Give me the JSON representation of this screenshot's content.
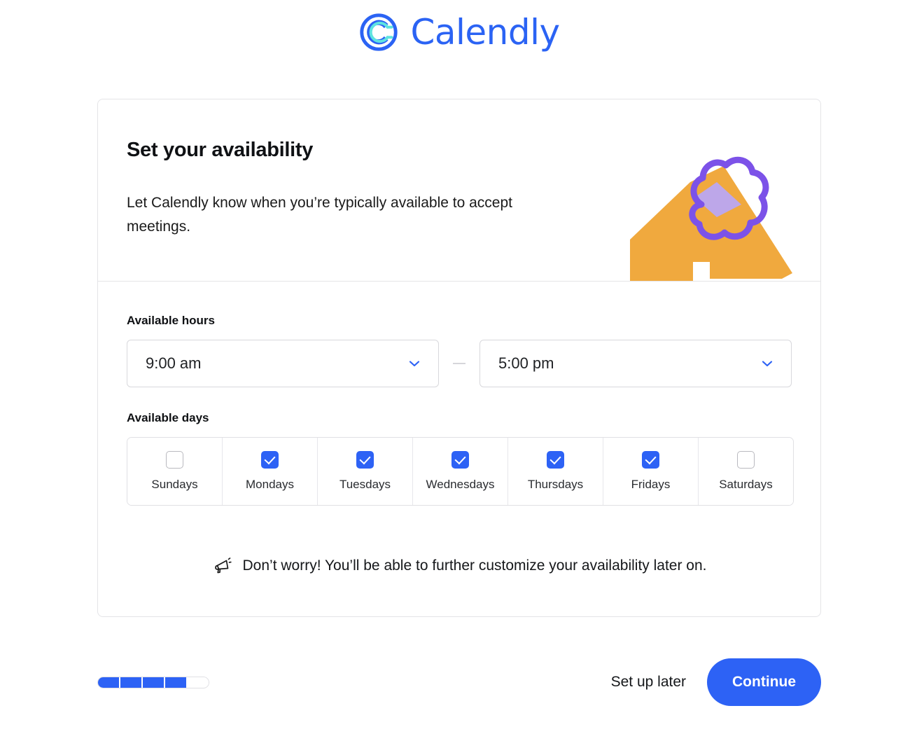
{
  "brand": {
    "name": "Calendly",
    "logo_icon": "calendly-c-logo-icon",
    "accent_color": "#2d62f5",
    "logo_inner_color": "#5fe3e0"
  },
  "card": {
    "title": "Set your availability",
    "subtitle": "Let Calendly know when you’re typically available to accept meetings.",
    "illustration": {
      "name": "abstract-shapes-illustration",
      "orange_color": "#f0a93e",
      "purple_color": "#7c52e8",
      "light_purple_color": "#b9a6f2"
    }
  },
  "hours": {
    "label": "Available hours",
    "start": {
      "value": "9:00 am",
      "icon": "chevron-down-icon"
    },
    "separator": "—",
    "end": {
      "value": "5:00 pm",
      "icon": "chevron-down-icon"
    }
  },
  "days": {
    "label": "Available days",
    "items": [
      {
        "label": "Sundays",
        "checked": false
      },
      {
        "label": "Mondays",
        "checked": true
      },
      {
        "label": "Tuesdays",
        "checked": true
      },
      {
        "label": "Wednesdays",
        "checked": true
      },
      {
        "label": "Thursdays",
        "checked": true
      },
      {
        "label": "Fridays",
        "checked": true
      },
      {
        "label": "Saturdays",
        "checked": false
      }
    ]
  },
  "note": {
    "icon": "megaphone-icon",
    "text": "Don’t worry! You’ll be able to further customize your availability later on."
  },
  "footer": {
    "progress": {
      "total_steps": 5,
      "completed_steps": 4
    },
    "set_up_later_label": "Set up later",
    "continue_label": "Continue"
  }
}
